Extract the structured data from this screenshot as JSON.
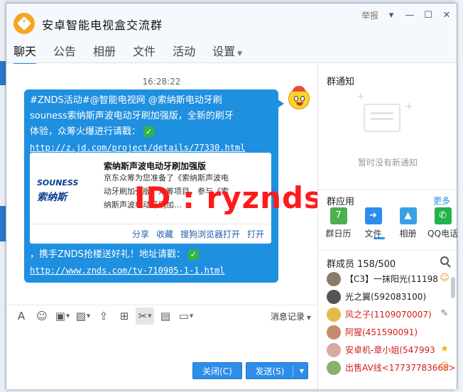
{
  "window": {
    "title": "安卓智能电视盒交流群",
    "report": "举报",
    "controls": {
      "dropdown": "▾",
      "minimize": "—",
      "maximize": "☐",
      "close": "✕"
    }
  },
  "tabs": [
    {
      "label": "聊天"
    },
    {
      "label": "公告"
    },
    {
      "label": "相册"
    },
    {
      "label": "文件"
    },
    {
      "label": "活动"
    },
    {
      "label": "设置"
    }
  ],
  "chat": {
    "timestamp": "16:28:22",
    "message": {
      "line1": "#ZNDS活动#@智能电视网 @索纳斯电动牙刷",
      "line2": "souness索纳斯声波电动牙刷加强版，全新的刷牙",
      "line3": "体验，众筹火爆进行请戳：",
      "link1": "http://z.jd.com/project/details/77330.html",
      "line4": "，携手ZNDS抢楼送好礼！地址请戳：",
      "link2": "http://www.znds.com/tv-710905-1-1.html"
    },
    "card": {
      "logo_line1": "SOUNESS",
      "logo_line2": "索纳斯",
      "title": "索纳斯声波电动牙刷加强版",
      "desc": "京东众筹为您准备了《索纳斯声波电动牙刷加强版》众筹项目，参与《索纳斯声波电动牙刷加...",
      "actions": [
        "分享",
        "收藏",
        "搜狗浏览器打开",
        "打开"
      ]
    },
    "watermark": "ID : ryznds"
  },
  "toolbar": {
    "history_label": "消息记录"
  },
  "buttons": {
    "close": "关闭(C)",
    "send": "发送(S)"
  },
  "right": {
    "notice_title": "群通知",
    "notice_empty": "暂时没有新通知",
    "apps_title": "群应用",
    "apps_more": "更多",
    "apps": [
      {
        "label": "群日历",
        "color": "#4caf50",
        "icon": "7"
      },
      {
        "label": "文件",
        "color": "#2d8cf0",
        "icon": "➜"
      },
      {
        "label": "相册",
        "color": "#39a0e6",
        "icon": "▲"
      },
      {
        "label": "QQ电话",
        "color": "#22b14c",
        "icon": "✆"
      }
    ],
    "members_title": "群成员 158/500",
    "members": [
      {
        "name": "【C3】一抹阳光(11198",
        "red": false,
        "color": "#8a7a6a",
        "side": "☺",
        "side_color": "#e59b2a"
      },
      {
        "name": "光之翼(592083100)",
        "red": false,
        "color": "#555555",
        "side": "",
        "side_color": ""
      },
      {
        "name": "风之子(1109070007)",
        "red": true,
        "color": "#e7b84a",
        "side": "✎",
        "side_color": "#777777"
      },
      {
        "name": "阿猩(451590091)",
        "red": true,
        "color": "#c78a6d",
        "side": "",
        "side_color": ""
      },
      {
        "name": "安卓机-章小姐(547993",
        "red": true,
        "color": "#d8a9a0",
        "side": "★",
        "side_color": "#f5b400"
      },
      {
        "name": "出售AV线<17737783668>",
        "red": true,
        "color": "#8ab06e",
        "side": "☺",
        "side_color": "#e59b2a"
      }
    ]
  },
  "colors": {
    "bubble": "#1f8fe0",
    "accent": "#2d8cf0",
    "watermark": "#ff1a1a"
  }
}
